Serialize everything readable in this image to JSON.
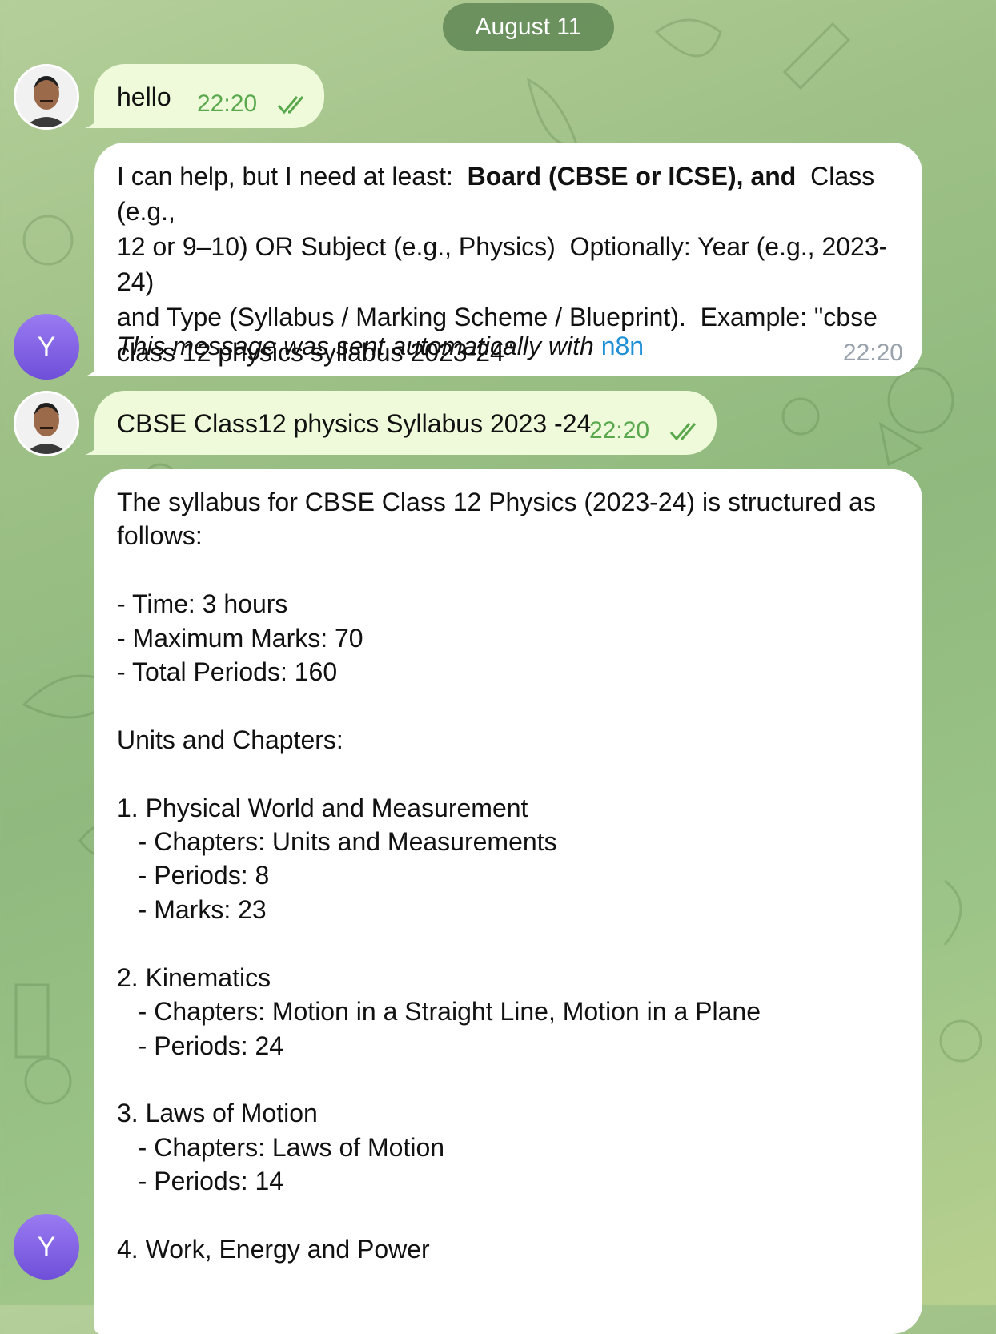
{
  "date_label": "August 11",
  "colors": {
    "outgoing_bubble": "#eefad9",
    "incoming_bubble": "#ffffff",
    "read_check": "#5aa84e",
    "link": "#1f8fd6"
  },
  "messages": [
    {
      "sender": "user",
      "text": "hello",
      "time": "22:20"
    },
    {
      "sender": "bot",
      "text_pre": "I can help, but I need at least:  ",
      "text_bold": "Board (CBSE or ICSE), and",
      "text_post": "  Class (e.g.,\n12 or 9–10) OR Subject (e.g., Physics)  Optionally: Year (e.g., 2023-24)\nand Type (Syllabus / Marking Scheme / Blueprint).  Example: \"cbse\nclass 12 physics syllabus 2023-24\"",
      "auto_text": "This message was sent automatically with ",
      "auto_link": "n8n",
      "time": "22:20",
      "avatar_letter": "Y"
    },
    {
      "sender": "user",
      "text": "CBSE Class12 physics Syllabus 2023 -24",
      "time": "22:20"
    },
    {
      "sender": "bot",
      "text": "The syllabus for CBSE Class 12 Physics (2023-24) is structured as\nfollows:\n\n- Time: 3 hours\n- Maximum Marks: 70\n- Total Periods: 160\n\nUnits and Chapters:\n\n1. Physical World and Measurement\n   - Chapters: Units and Measurements\n   - Periods: 8\n   - Marks: 23\n\n2. Kinematics\n   - Chapters: Motion in a Straight Line, Motion in a Plane\n   - Periods: 24\n\n3. Laws of Motion\n   - Chapters: Laws of Motion\n   - Periods: 14\n\n4. Work, Energy and Power",
      "avatar_letter": "Y"
    }
  ]
}
